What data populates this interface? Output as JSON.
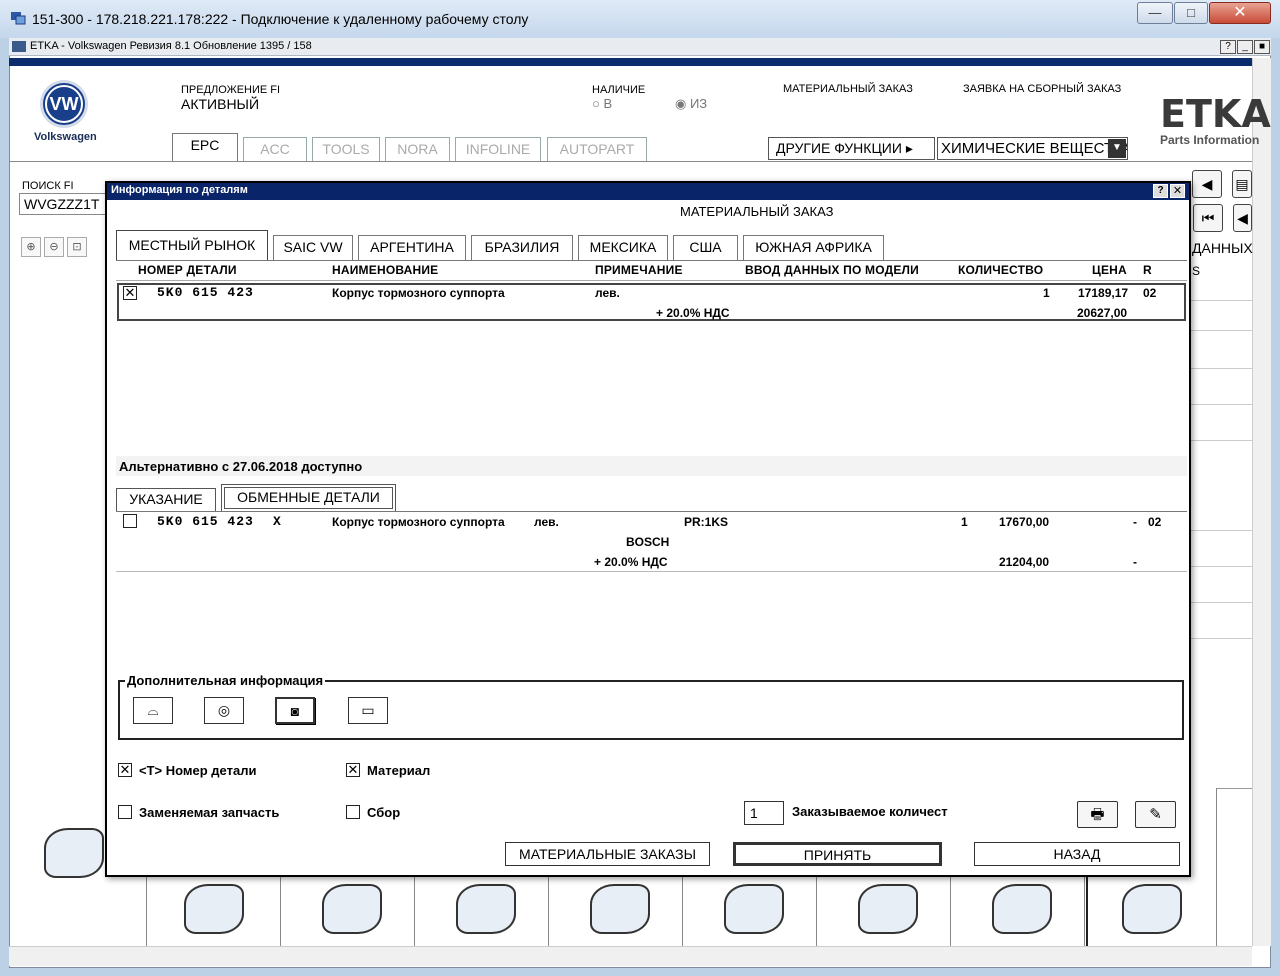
{
  "rdp": {
    "title": "151-300 - 178.218.221.178:222 - Подключение к удаленному рабочему столу",
    "min": "—",
    "max": "□",
    "close": "✕"
  },
  "etka": {
    "title": "ETKA - Volkswagen Ревизия 8.1 Обновление 1395 / 158",
    "help": "?",
    "min": "_",
    "close": "■"
  },
  "header": {
    "brand": "Volkswagen",
    "vw_logo_text": "VW",
    "fi_label": "ПРЕДЛОЖЕНИЕ FI",
    "fi_status": "АКТИВНЫЙ",
    "availability_label": "НАЛИЧИЕ",
    "avail_in": "○ В",
    "avail_from": "◉ ИЗ",
    "material_order": "МАТЕРИАЛЬНЫЙ ЗАКАЗ",
    "collective_order": "ЗАЯВКА НА СБОРНЫЙ ЗАКАЗ",
    "etka_logo": "ETKA",
    "etka_sub": "Parts Information"
  },
  "main_tabs": [
    {
      "label": "EPC"
    },
    {
      "label": "ACC"
    },
    {
      "label": "TOOLS"
    },
    {
      "label": "NORA"
    },
    {
      "label": "INFOLINE"
    },
    {
      "label": "AUTOPART"
    }
  ],
  "other_functions": "ДРУГИЕ ФУНКЦИИ ▸",
  "chem_select": "ХИМИЧЕСКИЕ ВЕЩЕСТВА",
  "search": {
    "label": "ПОИСК FI",
    "value": "WVGZZZ1T"
  },
  "bg_panel": {
    "data_label": "ДАННЫХ",
    "s_label": "S"
  },
  "dialog": {
    "title": "Информация по деталям",
    "help": "?",
    "close": "✕",
    "heading": "МАТЕРИАЛЬНЫЙ ЗАКАЗ",
    "market_tabs": [
      {
        "label": "МЕСТНЫЙ РЫНОК"
      },
      {
        "label": "SAIC VW"
      },
      {
        "label": "АРГЕНТИНА"
      },
      {
        "label": "БРАЗИЛИЯ"
      },
      {
        "label": "МЕКСИКА"
      },
      {
        "label": "США"
      },
      {
        "label": "ЮЖНАЯ АФРИКА"
      }
    ],
    "columns": {
      "part_no": "НОМЕР ДЕТАЛИ",
      "name": "НАИМЕНОВАНИЕ",
      "note": "ПРИМЕЧАНИЕ",
      "model_data": "ВВОД ДАННЫХ ПО МОДЕЛИ",
      "qty": "КОЛИЧЕСТВО",
      "price": "ЦЕНА",
      "r": "R"
    },
    "order_row": {
      "checked": "✕",
      "part_no": "5K0 615 423",
      "name": "Корпус тормозного суппорта",
      "note": "лев.",
      "qty": "1",
      "price": "17189,17",
      "r": "02",
      "vat_label": "+ 20.0% НДС",
      "price_vat": "20627,00"
    },
    "alternative_text": "Альтернативно с 27.06.2018 доступно",
    "sub_tabs": [
      {
        "label": "УКАЗАНИЕ"
      },
      {
        "label": "ОБМЕННЫЕ ДЕТАЛИ"
      }
    ],
    "alt_row": {
      "part_no": "5K0 615 423",
      "suffix": "X",
      "name": "Корпус тормозного суппорта",
      "note": "лев.",
      "pr": "PR:1KS",
      "brand": "BOSCH",
      "qty": "1",
      "price": "17670,00",
      "dash": "-",
      "r": "02",
      "vat_label": "+ 20.0% НДС",
      "price_vat": "21204,00",
      "dash2": "-"
    },
    "additional_info": {
      "legend": "Дополнительная информация",
      "buttons": [
        "⌓",
        "◎",
        "◙",
        "▭"
      ]
    },
    "options": {
      "part_number_label": "<T> Номер детали",
      "material_label": "Материал",
      "replaceable_label": "Заменяемая запчасть",
      "assembly_label": "Сбор",
      "checked_mark": "✕"
    },
    "quantity": {
      "value": "1",
      "label": "Заказываемое количест"
    },
    "tool_icons": {
      "print": "🖶",
      "edit": "✎"
    },
    "buttons": {
      "material_orders": "МАТЕРИАЛЬНЫЕ ЗАКАЗЫ",
      "accept": "ПРИНЯТЬ",
      "back": "НАЗАД"
    }
  },
  "colors": {
    "dialog_titlebar": "#0a246a",
    "header_rule": "#0b2d6e",
    "rdp_titlebar": "#c5d7ec"
  }
}
